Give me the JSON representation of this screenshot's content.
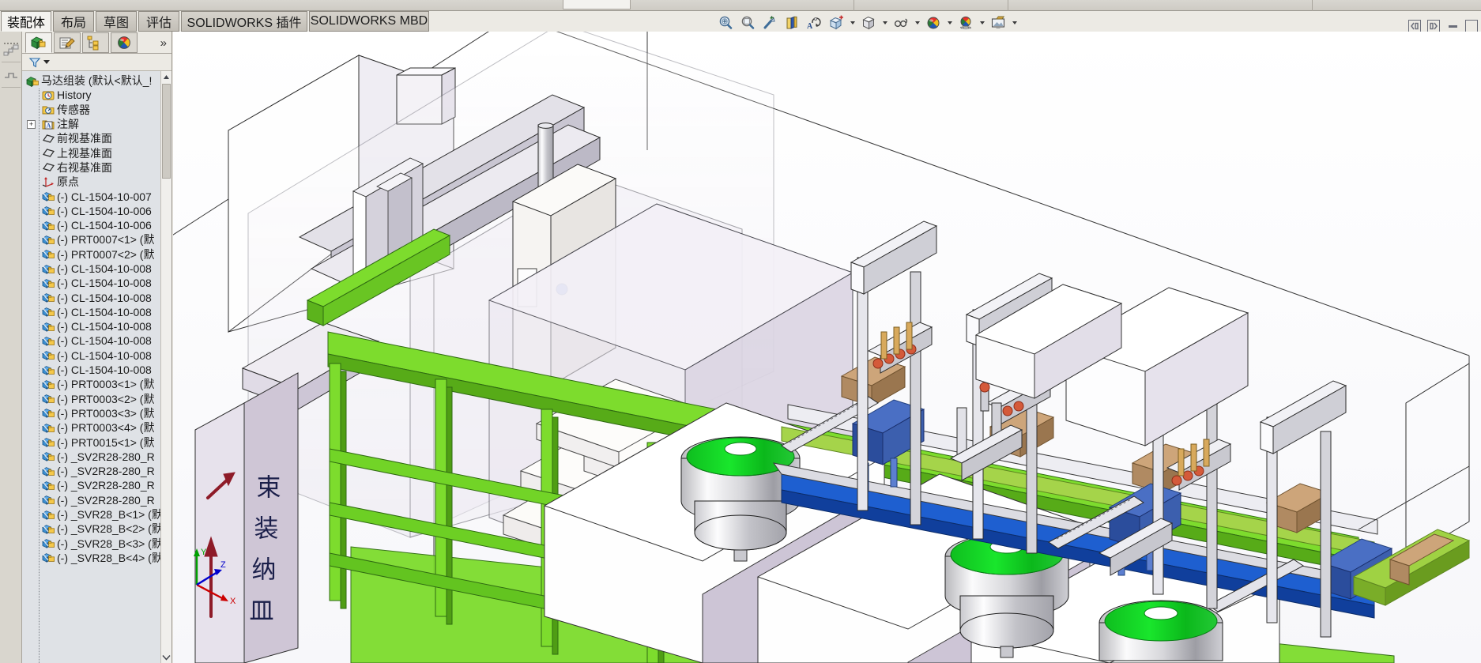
{
  "app": {
    "title": "SOLIDWORKS",
    "active_document": "马达组装"
  },
  "command_tabs": [
    {
      "label": "装配体",
      "active": true
    },
    {
      "label": "布局",
      "active": false
    },
    {
      "label": "草图",
      "active": false
    },
    {
      "label": "评估",
      "active": false
    },
    {
      "label": "SOLIDWORKS 插件",
      "active": false
    },
    {
      "label": "SOLIDWORKS MBD",
      "active": false
    }
  ],
  "view_toolbar": [
    {
      "name": "zoom-to-fit-icon",
      "glyph": "zoom-fit",
      "has_caret": false
    },
    {
      "name": "zoom-to-area-icon",
      "glyph": "zoom-area",
      "has_caret": false
    },
    {
      "name": "previous-view-icon",
      "glyph": "prev-view",
      "has_caret": false
    },
    {
      "name": "section-view-icon",
      "glyph": "section",
      "has_caret": false
    },
    {
      "name": "view-orientation-icon",
      "glyph": "orient",
      "has_caret": false
    },
    {
      "name": "display-style-icon",
      "glyph": "display-style",
      "has_caret": true
    },
    {
      "name": "hide-show-items-icon",
      "glyph": "hide-show",
      "has_caret": true
    },
    {
      "name": "edit-appearance-icon",
      "glyph": "glasses",
      "has_caret": true
    },
    {
      "name": "apply-scene-icon",
      "glyph": "sphere",
      "has_caret": true
    },
    {
      "name": "view-settings-icon",
      "glyph": "sphere-shadow",
      "has_caret": true
    },
    {
      "name": "screen-capture-icon",
      "glyph": "capture",
      "has_caret": true
    }
  ],
  "window_controls": [
    {
      "name": "restore-pane-left-button",
      "glyph": "pane-left"
    },
    {
      "name": "restore-pane-right-button",
      "glyph": "pane-right"
    },
    {
      "name": "minimize-button",
      "glyph": "minimize"
    },
    {
      "name": "maximize-button",
      "glyph": "maximize"
    }
  ],
  "left_dock": [
    {
      "name": "dock-icon-flyout-tree",
      "glyph": "tree-flyout"
    },
    {
      "name": "dock-icon-display-state",
      "glyph": "display-state"
    }
  ],
  "feature_manager": {
    "tabs": [
      {
        "name": "feature-manager-design-tree-tab",
        "glyph": "design-tree",
        "active": true
      },
      {
        "name": "property-manager-tab",
        "glyph": "property-manager",
        "active": false
      },
      {
        "name": "configuration-manager-tab",
        "glyph": "configuration-manager",
        "active": false
      },
      {
        "name": "display-manager-tab",
        "glyph": "display-manager",
        "active": false
      }
    ],
    "overflow_label": "»",
    "filter_placeholder": "",
    "root": {
      "label": "马达组装 (默认<默认_!",
      "icon": "assembly-icon"
    },
    "items": [
      {
        "label": "History",
        "icon": "history-icon",
        "indent": 1,
        "expandable": false
      },
      {
        "label": "传感器",
        "icon": "sensor-icon",
        "indent": 1,
        "expandable": false
      },
      {
        "label": "注解",
        "icon": "annotation-icon",
        "indent": 1,
        "expandable": true
      },
      {
        "label": "前视基准面",
        "icon": "plane-icon",
        "indent": 1,
        "expandable": false
      },
      {
        "label": "上视基准面",
        "icon": "plane-icon",
        "indent": 1,
        "expandable": false
      },
      {
        "label": "右视基准面",
        "icon": "plane-icon",
        "indent": 1,
        "expandable": false
      },
      {
        "label": "原点",
        "icon": "origin-icon",
        "indent": 1,
        "expandable": false
      },
      {
        "label": "(-) CL-1504-10-007",
        "icon": "component-icon",
        "indent": 1,
        "expandable": false
      },
      {
        "label": "(-) CL-1504-10-006",
        "icon": "component-icon",
        "indent": 1,
        "expandable": false
      },
      {
        "label": "(-) CL-1504-10-006",
        "icon": "component-icon",
        "indent": 1,
        "expandable": false
      },
      {
        "label": "(-) PRT0007<1> (默",
        "icon": "component-icon",
        "indent": 1,
        "expandable": false
      },
      {
        "label": "(-) PRT0007<2> (默",
        "icon": "component-icon",
        "indent": 1,
        "expandable": false
      },
      {
        "label": "(-) CL-1504-10-008",
        "icon": "component-icon",
        "indent": 1,
        "expandable": false
      },
      {
        "label": "(-) CL-1504-10-008",
        "icon": "component-icon",
        "indent": 1,
        "expandable": false
      },
      {
        "label": "(-) CL-1504-10-008",
        "icon": "component-icon",
        "indent": 1,
        "expandable": false
      },
      {
        "label": "(-) CL-1504-10-008",
        "icon": "component-icon",
        "indent": 1,
        "expandable": false
      },
      {
        "label": "(-) CL-1504-10-008",
        "icon": "component-icon",
        "indent": 1,
        "expandable": false
      },
      {
        "label": "(-) CL-1504-10-008",
        "icon": "component-icon",
        "indent": 1,
        "expandable": false
      },
      {
        "label": "(-) CL-1504-10-008",
        "icon": "component-icon",
        "indent": 1,
        "expandable": false
      },
      {
        "label": "(-) CL-1504-10-008",
        "icon": "component-icon",
        "indent": 1,
        "expandable": false
      },
      {
        "label": "(-) PRT0003<1> (默",
        "icon": "component-icon",
        "indent": 1,
        "expandable": false
      },
      {
        "label": "(-) PRT0003<2> (默",
        "icon": "component-icon",
        "indent": 1,
        "expandable": false
      },
      {
        "label": "(-) PRT0003<3> (默",
        "icon": "component-icon",
        "indent": 1,
        "expandable": false
      },
      {
        "label": "(-) PRT0003<4> (默",
        "icon": "component-icon",
        "indent": 1,
        "expandable": false
      },
      {
        "label": "(-) PRT0015<1> (默",
        "icon": "component-icon",
        "indent": 1,
        "expandable": false
      },
      {
        "label": "(-) _SV2R28-280_R",
        "icon": "component-icon",
        "indent": 1,
        "expandable": false
      },
      {
        "label": "(-) _SV2R28-280_R",
        "icon": "component-icon",
        "indent": 1,
        "expandable": false
      },
      {
        "label": "(-) _SV2R28-280_R",
        "icon": "component-icon",
        "indent": 1,
        "expandable": false
      },
      {
        "label": "(-) _SV2R28-280_R",
        "icon": "component-icon",
        "indent": 1,
        "expandable": false
      },
      {
        "label": "(-) _SVR28_B<1> (默",
        "icon": "component-icon",
        "indent": 1,
        "expandable": false
      },
      {
        "label": "(-) _SVR28_B<2> (默",
        "icon": "component-icon",
        "indent": 1,
        "expandable": false
      },
      {
        "label": "(-) _SVR28_B<3> (默",
        "icon": "component-icon",
        "indent": 1,
        "expandable": false
      },
      {
        "label": "(-) _SVR28_B<4> (默",
        "icon": "component-icon",
        "indent": 1,
        "expandable": false
      }
    ]
  },
  "viewport": {
    "model_name": "马达组装",
    "annotation_text": "束装纳皿",
    "triad_axes": [
      {
        "label": "Y",
        "color": "#00a000"
      },
      {
        "label": "X",
        "color": "#cc0000"
      },
      {
        "label": "Z",
        "color": "#0000cc"
      }
    ],
    "colors": {
      "frame_green": "#7cdc2a",
      "feeder_green": "#00cc22",
      "conveyor_blue": "#1e5fd0",
      "machine_violet": "#c4bacd",
      "base_white": "#ffffff",
      "steel_grey": "#b9b9bd",
      "annotation_navy": "#1b1f4a",
      "arrow_red": "#8e1b28",
      "carton_tan": "#b08a62",
      "background": "#ffffff"
    }
  }
}
